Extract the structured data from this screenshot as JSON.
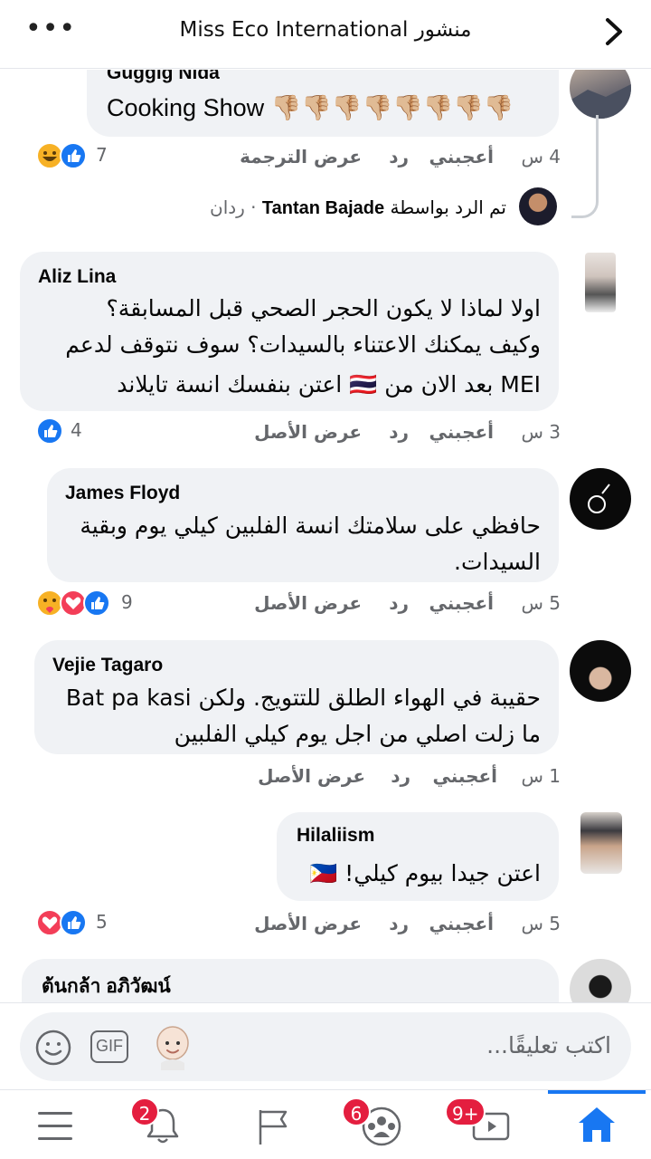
{
  "header": {
    "title": "Miss Eco International منشور",
    "more_icon": "more-horizontal-icon",
    "forward_icon": "chevron-right-icon"
  },
  "comments": [
    {
      "author": "Guggig Nida",
      "text": "Cooking Show 👎🏼👎🏼👎🏼👎🏼👎🏼👎🏼👎🏼👎🏼",
      "time": "4 س",
      "like": "أعجبني",
      "reply": "رد",
      "translate": "عرض الترجمة",
      "reaction_count": "7",
      "reactions": [
        "haha",
        "like"
      ],
      "replied_by": "Tantan Bajade",
      "replied_prefix": "تم الرد بواسطة",
      "replied_suffix": "· ردان"
    },
    {
      "author": "Aliz Lina",
      "line1": "اولا لماذا لا يكون الحجر الصحي قبل المسابقة؟",
      "line2": "وكيف يمكنك الاعتناء بالسيدات؟ سوف نتوقف لدعم",
      "line3": "MEI بعد الان من 🇹🇭 اعتن بنفسك انسة تايلاند",
      "time": "3 س",
      "like": "أعجبني",
      "reply": "رد",
      "original": "عرض الأصل",
      "reaction_count": "4",
      "reactions": [
        "like"
      ]
    },
    {
      "author": "James Floyd",
      "line1": "حافظي على سلامتك انسة الفلبين كيلي يوم وبقية",
      "line2": "السيدات.",
      "time": "5 س",
      "like": "أعجبني",
      "reply": "رد",
      "original": "عرض الأصل",
      "reaction_count": "9",
      "reactions": [
        "care",
        "love",
        "like"
      ]
    },
    {
      "author": "Vejie Tagaro",
      "line1": "حقيبة في الهواء الطلق للتتويج. ولكن Bat pa kasi",
      "line2": "ما زلت اصلي من اجل يوم كيلي الفلبين",
      "time": "1 س",
      "like": "أعجبني",
      "reply": "رد",
      "original": "عرض الأصل"
    },
    {
      "author": "Hilaliism",
      "line1": "اعتن جيدا بيوم كيلي! 🇵🇭",
      "time": "5 س",
      "like": "أعجبني",
      "reply": "رد",
      "original": "عرض الأصل",
      "reaction_count": "5",
      "reactions": [
        "love",
        "like"
      ]
    },
    {
      "author": "ต้นกล้า อภิวัฒน์"
    }
  ],
  "composer": {
    "placeholder": "اكتب تعليقًا...",
    "gif_label": "GIF",
    "emoji_icon": "smiley-icon",
    "avatar_icon": "avatar-sticker-icon"
  },
  "nav": {
    "notifications_badge": "2",
    "groups_badge": "6",
    "watch_badge": "9+",
    "colors": {
      "accent": "#1877f2",
      "badge": "#e41e3f"
    }
  }
}
